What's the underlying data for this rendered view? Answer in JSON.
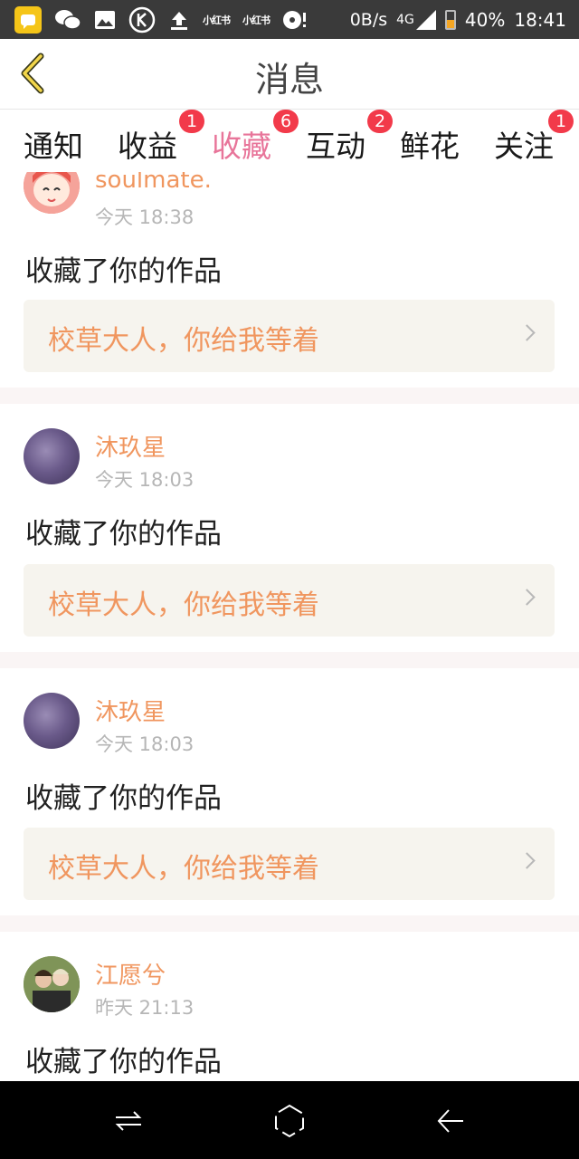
{
  "status_bar": {
    "app_mark_1": "小红书",
    "app_mark_2": "小红书",
    "net_speed": "0B/s",
    "network_type": "4G",
    "battery_percent": "40%",
    "time": "18:41"
  },
  "header": {
    "title": "消息"
  },
  "tabs": [
    {
      "label": "通知",
      "badge": ""
    },
    {
      "label": "收益",
      "badge": "1"
    },
    {
      "label": "收藏",
      "badge": "6",
      "active": true
    },
    {
      "label": "互动",
      "badge": "2"
    },
    {
      "label": "鲜花",
      "badge": ""
    },
    {
      "label": "关注",
      "badge": "1"
    }
  ],
  "items": [
    {
      "user": "soulmate.",
      "time": "今天 18:38",
      "action": "收藏了你的作品",
      "work": "校草大人，你给我等着"
    },
    {
      "user": "沐玖星",
      "time": "今天 18:03",
      "action": "收藏了你的作品",
      "work": "校草大人，你给我等着"
    },
    {
      "user": "沐玖星",
      "time": "今天 18:03",
      "action": "收藏了你的作品",
      "work": "校草大人，你给我等着"
    },
    {
      "user": "江愿兮",
      "time": "昨天 21:13",
      "action": "收藏了你的作品",
      "work": ""
    }
  ],
  "colors": {
    "accent_pink": "#e8759a",
    "name_orange": "#f0965f",
    "badge_red": "#f23a4a",
    "status_bar_bg": "#3a3a3a"
  },
  "icons": {
    "back": "chevron-left-icon",
    "nav_recent": "switch-icon",
    "nav_home": "home-hexagon-icon",
    "nav_back": "arrow-left-icon"
  }
}
